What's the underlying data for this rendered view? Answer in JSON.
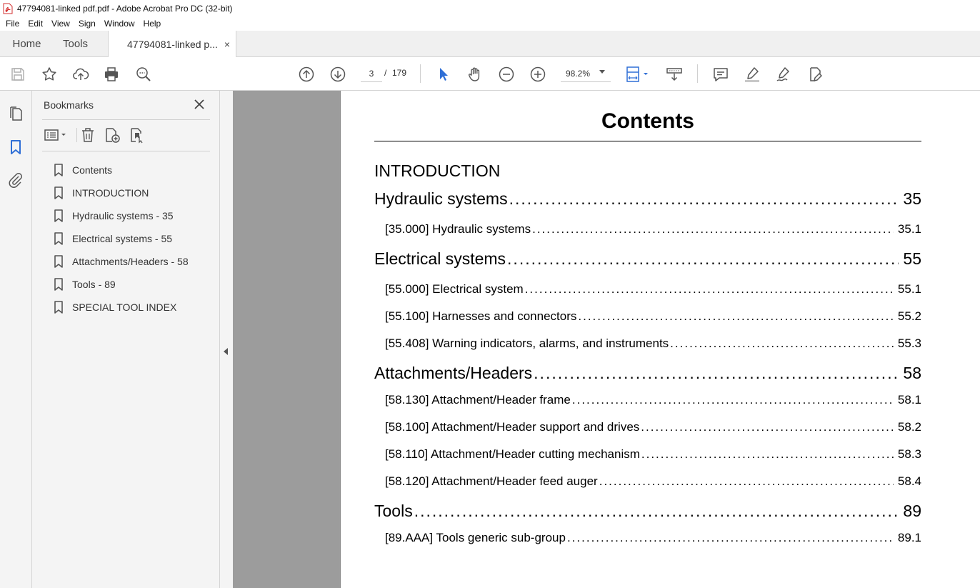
{
  "window": {
    "title": "47794081-linked pdf.pdf - Adobe Acrobat Pro DC (32-bit)"
  },
  "menu": [
    "File",
    "Edit",
    "View",
    "Sign",
    "Window",
    "Help"
  ],
  "tabs": {
    "home": "Home",
    "tools": "Tools",
    "document": "47794081-linked p...",
    "close_glyph": "×"
  },
  "toolbar": {
    "current_page": "3",
    "page_separator": "/",
    "total_pages": "179",
    "zoom": "98.2%",
    "icons": [
      "save-icon",
      "bookmark-star-icon",
      "upload-icon",
      "print-icon",
      "search-zoom-icon",
      "prev-page-icon",
      "next-page-icon",
      "select-cursor-icon",
      "hand-icon",
      "zoom-out-icon",
      "zoom-in-icon",
      "page-fit-icon",
      "scroll-mode-icon",
      "comment-icon",
      "highlight-icon",
      "sign-icon",
      "edit-pdf-icon"
    ]
  },
  "bookmarks_panel": {
    "title": "Bookmarks",
    "items": [
      "Contents",
      "INTRODUCTION",
      "Hydraulic systems - 35",
      "Electrical systems - 55",
      "Attachments/Headers - 58",
      "Tools - 89",
      "SPECIAL TOOL INDEX"
    ]
  },
  "document": {
    "title": "Contents",
    "introduction": "INTRODUCTION",
    "toc": [
      {
        "level": 1,
        "text": "Hydraulic systems",
        "page": "35"
      },
      {
        "level": 2,
        "text": "[35.000] Hydraulic systems",
        "page": "35.1"
      },
      {
        "level": 1,
        "text": "Electrical systems",
        "page": "55"
      },
      {
        "level": 2,
        "text": "[55.000] Electrical system",
        "page": "55.1"
      },
      {
        "level": 2,
        "text": "[55.100] Harnesses and connectors",
        "page": "55.2"
      },
      {
        "level": 2,
        "text": "[55.408] Warning indicators, alarms, and instruments",
        "page": "55.3"
      },
      {
        "level": 1,
        "text": "Attachments/Headers",
        "page": "58"
      },
      {
        "level": 2,
        "text": "[58.130] Attachment/Header frame",
        "page": "58.1"
      },
      {
        "level": 2,
        "text": "[58.100] Attachment/Header support and drives",
        "page": "58.2"
      },
      {
        "level": 2,
        "text": "[58.110] Attachment/Header cutting mechanism",
        "page": "58.3"
      },
      {
        "level": 2,
        "text": "[58.120] Attachment/Header feed auger",
        "page": "58.4"
      },
      {
        "level": 1,
        "text": "Tools",
        "page": "89"
      },
      {
        "level": 2,
        "text": "[89.AAA] Tools generic sub-group",
        "page": "89.1"
      }
    ]
  },
  "colors": {
    "accent": "#2f6fd6",
    "chrome": "#f4f4f4",
    "viewer_bg": "#9c9c9c",
    "pdf_red": "#d32f2f"
  }
}
